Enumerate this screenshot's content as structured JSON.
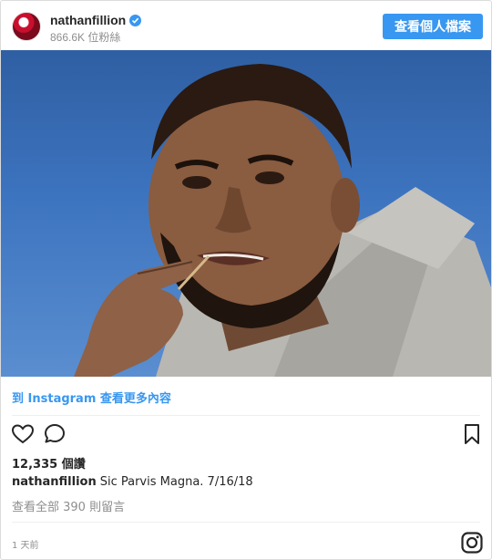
{
  "header": {
    "username": "nathanfillion",
    "followers": "866.6K 位粉絲",
    "view_profile_label": "查看個人檔案"
  },
  "post": {
    "more_link": "到 Instagram 查看更多內容",
    "likes": "12,335 個讚",
    "caption_user": "nathanfillion",
    "caption_text": "Sic Parvis Magna. 7/16/18",
    "view_comments": "查看全部 390 則留言",
    "timestamp": "1 天前"
  },
  "icons": {
    "verified": "verified-badge-icon",
    "like": "heart-icon",
    "comment": "comment-icon",
    "save": "bookmark-icon",
    "brand": "instagram-logo-icon"
  },
  "colors": {
    "accent": "#3897f0",
    "text": "#262626",
    "muted": "#8e8e8e"
  }
}
